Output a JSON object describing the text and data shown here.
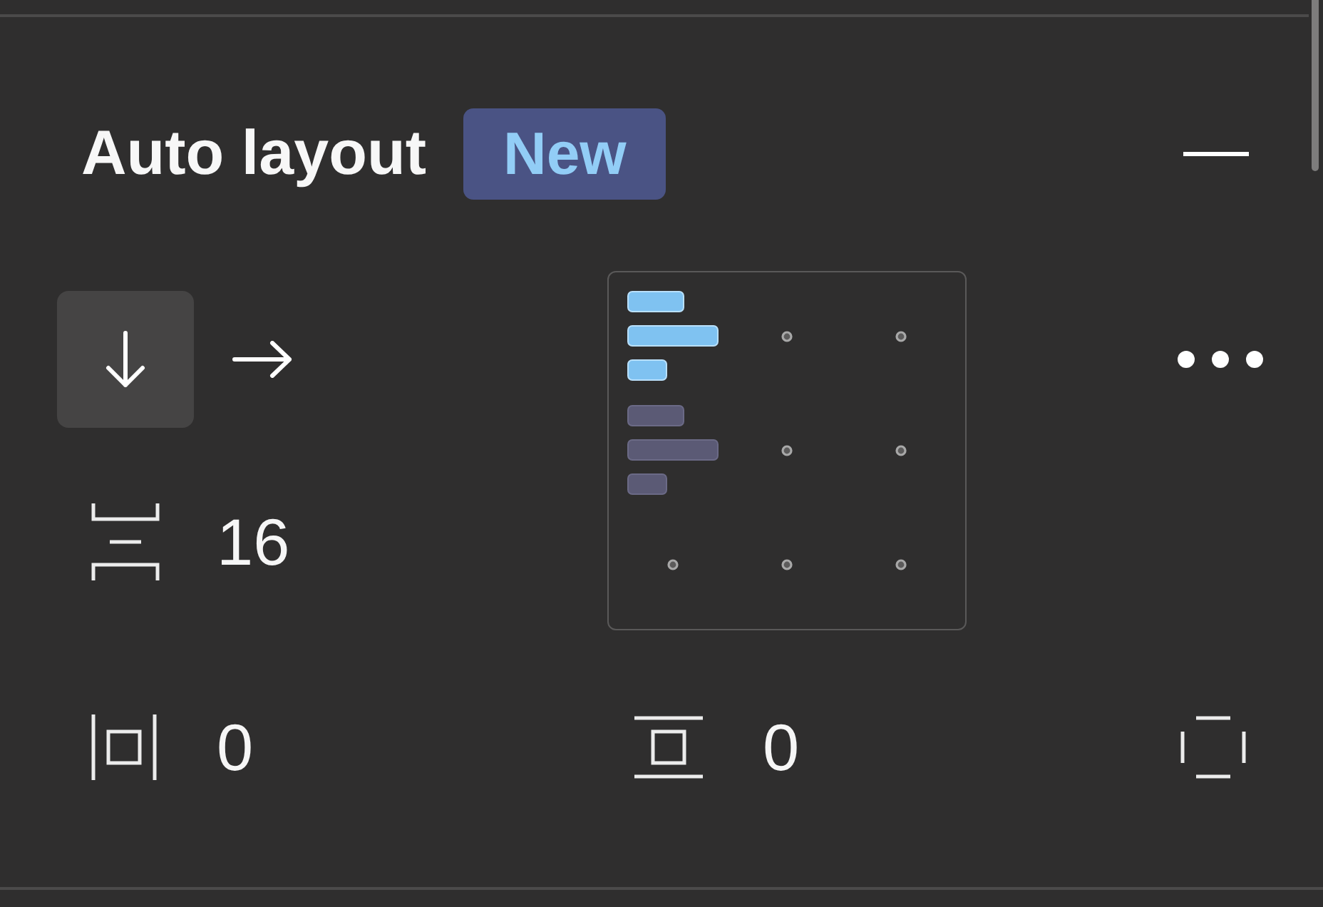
{
  "panel": {
    "title": "Auto layout",
    "badge": "New"
  },
  "direction": [
    {
      "kind": "vertical",
      "selected": true
    },
    {
      "kind": "horizontal",
      "selected": false
    }
  ],
  "gap": {
    "value": "16"
  },
  "alignment": {
    "cells": [
      {
        "selected": true,
        "hovered": false
      },
      {
        "selected": false,
        "hovered": false
      },
      {
        "selected": false,
        "hovered": false
      },
      {
        "selected": false,
        "hovered": true
      },
      {
        "selected": false,
        "hovered": false
      },
      {
        "selected": false,
        "hovered": false
      },
      {
        "selected": false,
        "hovered": false
      },
      {
        "selected": false,
        "hovered": false
      },
      {
        "selected": false,
        "hovered": false
      }
    ]
  },
  "padding": [
    {
      "kind": "horizontal",
      "value": "0"
    },
    {
      "kind": "vertical",
      "value": "0"
    }
  ]
}
